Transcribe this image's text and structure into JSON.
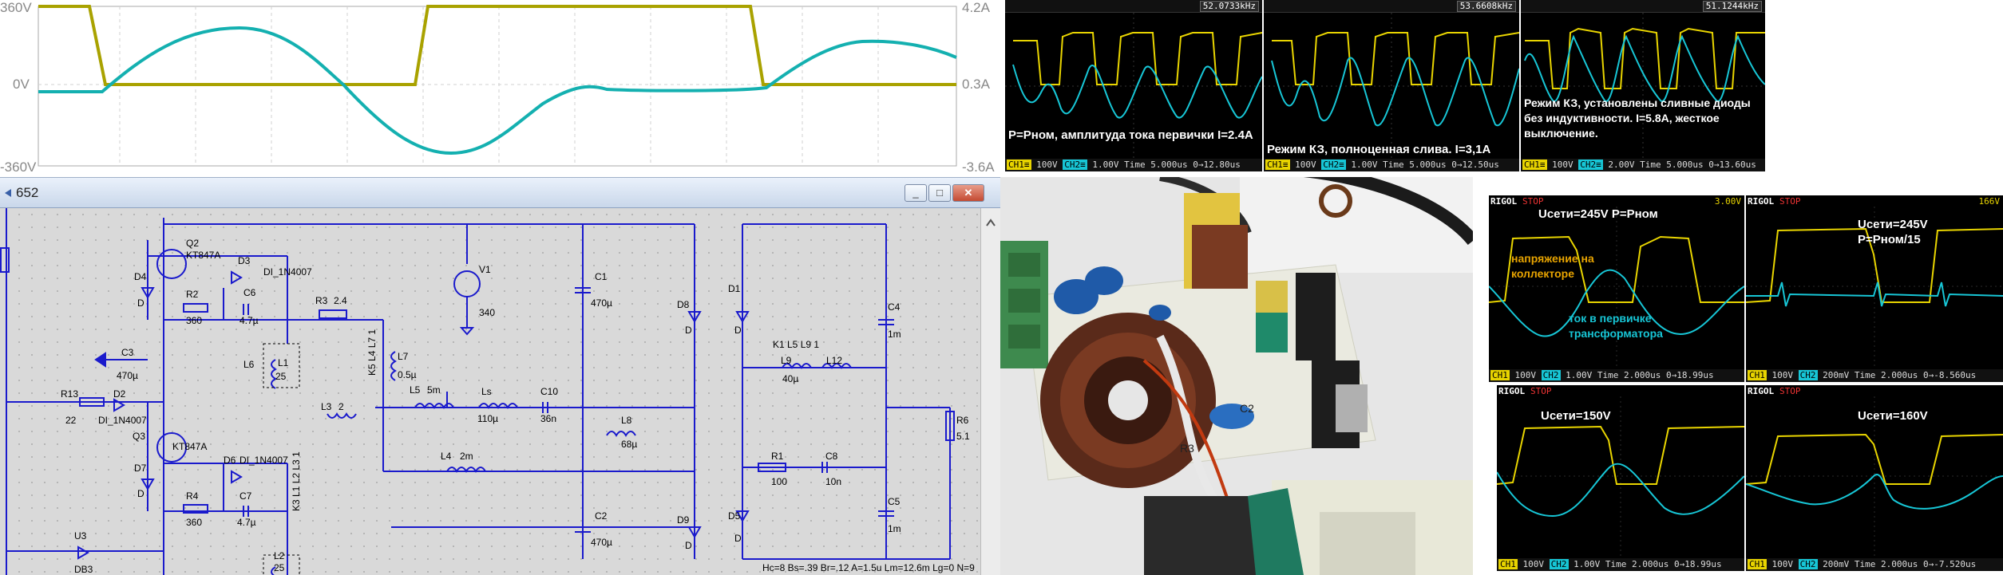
{
  "waveform_plot": {
    "left_axis": {
      "top": "360V",
      "mid": "0V",
      "bottom": "-360V"
    },
    "right_axis": {
      "top": "4.2A",
      "mid": "0.3A",
      "bottom": "-3.6A"
    }
  },
  "ltspice": {
    "window_title": "652",
    "buttons": {
      "minimize": "_",
      "maximize": "□",
      "close": "✕"
    },
    "params": "Hc=8 Bs=.39 Br=.12 A=1.5u Lm=12.6m Lg=0 N=9",
    "components": {
      "Q2": "Q2",
      "Q2_model": "KT847A",
      "Q3": "Q3",
      "Q3_model": "KT847A",
      "D3": "D3",
      "D3_model": "DI_1N4007",
      "D4": "D4",
      "D4_d": "D",
      "D6": "D6",
      "D6_model": "DI_1N4007",
      "D7": "D7",
      "D7_d": "D",
      "D2": "D2",
      "D2_model": "DI_1N4007",
      "R2": "R2",
      "R2_v": "360",
      "R4": "R4",
      "R4_v": "360",
      "R3": "R3",
      "R3_v": "2.4",
      "R13": "R13",
      "R13_v": "22",
      "C6": "C6",
      "C6_v": "4.7µ",
      "C7": "C7",
      "C7_v": "4.7µ",
      "C3": "C3",
      "C3_v": "470µ",
      "L6": "L6",
      "L1": "L1",
      "L1_v": "25",
      "L2": "L2",
      "L2_v": "25",
      "L3": "L3",
      "L3_v": "2",
      "K3": "K3 L1 L2 L3 1",
      "K5": "K5 L4 L7 1",
      "L7": "L7",
      "L7_v": "0.5µ",
      "L5": "L5",
      "L5_v": "5m",
      "Ls": "Ls",
      "Ls_v": "110µ",
      "L4": "L4",
      "L4_v": "2m",
      "C10": "C10",
      "C10_v": "36n",
      "L8": "L8",
      "L8_v": "68µ",
      "V1": "V1",
      "V1_v": "340",
      "C1": "C1",
      "C1_v": "470µ",
      "C2": "C2",
      "C2_v": "470µ",
      "D8": "D8",
      "D8_d": "D",
      "D9": "D9",
      "D9_d": "D",
      "U3": "U3",
      "U3_v": "DB3",
      "D1": "D1",
      "D1_d": "D",
      "D5": "D5",
      "D5_d": "D",
      "K1": "K1 L5 L9 1",
      "L9": "L9",
      "L9_v": "40µ",
      "L12": "L12",
      "R1": "R1",
      "R1_v": "100",
      "C8": "C8",
      "C8_v": "10n",
      "C4": "C4",
      "C4_v": "1m",
      "C5": "C5",
      "C5_v": "1m",
      "R6": "R6",
      "R6_v": "5.1"
    }
  },
  "scopes_top": [
    {
      "freq": "52.0733kHz",
      "caption": "P=Рном, амплитуда тока первички I=2.4А",
      "ftr": {
        "ch1": "CH1≡",
        "ch1v": "100V",
        "ch2": "CH2≡",
        "ch2v": "1.00V",
        "time": "Time 5.000us",
        "trig": "0→12.80us"
      }
    },
    {
      "freq": "53.6608kHz",
      "caption": "Режим КЗ, полноценная слива. I=3,1А",
      "ftr": {
        "ch1": "CH1≡",
        "ch1v": "100V",
        "ch2": "CH2≡",
        "ch2v": "1.00V",
        "time": "Time 5.000us",
        "trig": "0→12.50us"
      }
    },
    {
      "freq": "51.1244kHz",
      "caption": "Режим КЗ, установлены сливные диоды без индуктивности. I=5.8А, жесткое выключение.",
      "ftr": {
        "ch1": "CH1≡",
        "ch1v": "100V",
        "ch2": "CH2≡",
        "ch2v": "2.00V",
        "time": "Time 5.000us",
        "trig": "0→13.60us"
      }
    }
  ],
  "scopes_bottom": [
    {
      "brand": "RIGOL",
      "status": "STOP",
      "caption": "Uсети=245V  P=Рном",
      "note1": "напряжение на коллекторе",
      "note2": "ток в первичке трансформатора",
      "corner": "3.00V",
      "ftr": {
        "ch1": "CH1",
        "ch1v": "100V",
        "ch2": "CH2",
        "ch2v": "1.00V",
        "time": "Time 2.000us",
        "trig": "0→18.99us"
      }
    },
    {
      "brand": "RIGOL",
      "status": "STOP",
      "caption": "Uсети=245V\nP=Рном/15",
      "corner": "166V",
      "ftr": {
        "ch1": "CH1",
        "ch1v": "100V",
        "ch2": "CH2",
        "ch2v": "200mV",
        "time": "Time 2.000us",
        "trig": "0→-8.560us"
      }
    },
    {
      "brand": "RIGOL",
      "status": "STOP",
      "caption": "Uсети=150V",
      "corner": "",
      "ftr": {
        "ch1": "CH1",
        "ch1v": "100V",
        "ch2": "CH2",
        "ch2v": "1.00V",
        "time": "Time 2.000us",
        "trig": "0→18.99us"
      }
    },
    {
      "brand": "RIGOL",
      "status": "STOP",
      "caption": "Uсети=160V",
      "corner": "",
      "ftr": {
        "ch1": "CH1",
        "ch1v": "100V",
        "ch2": "CH2",
        "ch2v": "200mV",
        "time": "Time 2.000us",
        "trig": "0→-7.520us"
      }
    }
  ],
  "photo": {
    "board_labels": [
      "C2",
      "R3"
    ]
  },
  "colors": {
    "voltage": "#a9a200",
    "current": "#14b0b0",
    "scope_ch1": "#e8d400",
    "scope_ch2": "#17c6d6"
  }
}
